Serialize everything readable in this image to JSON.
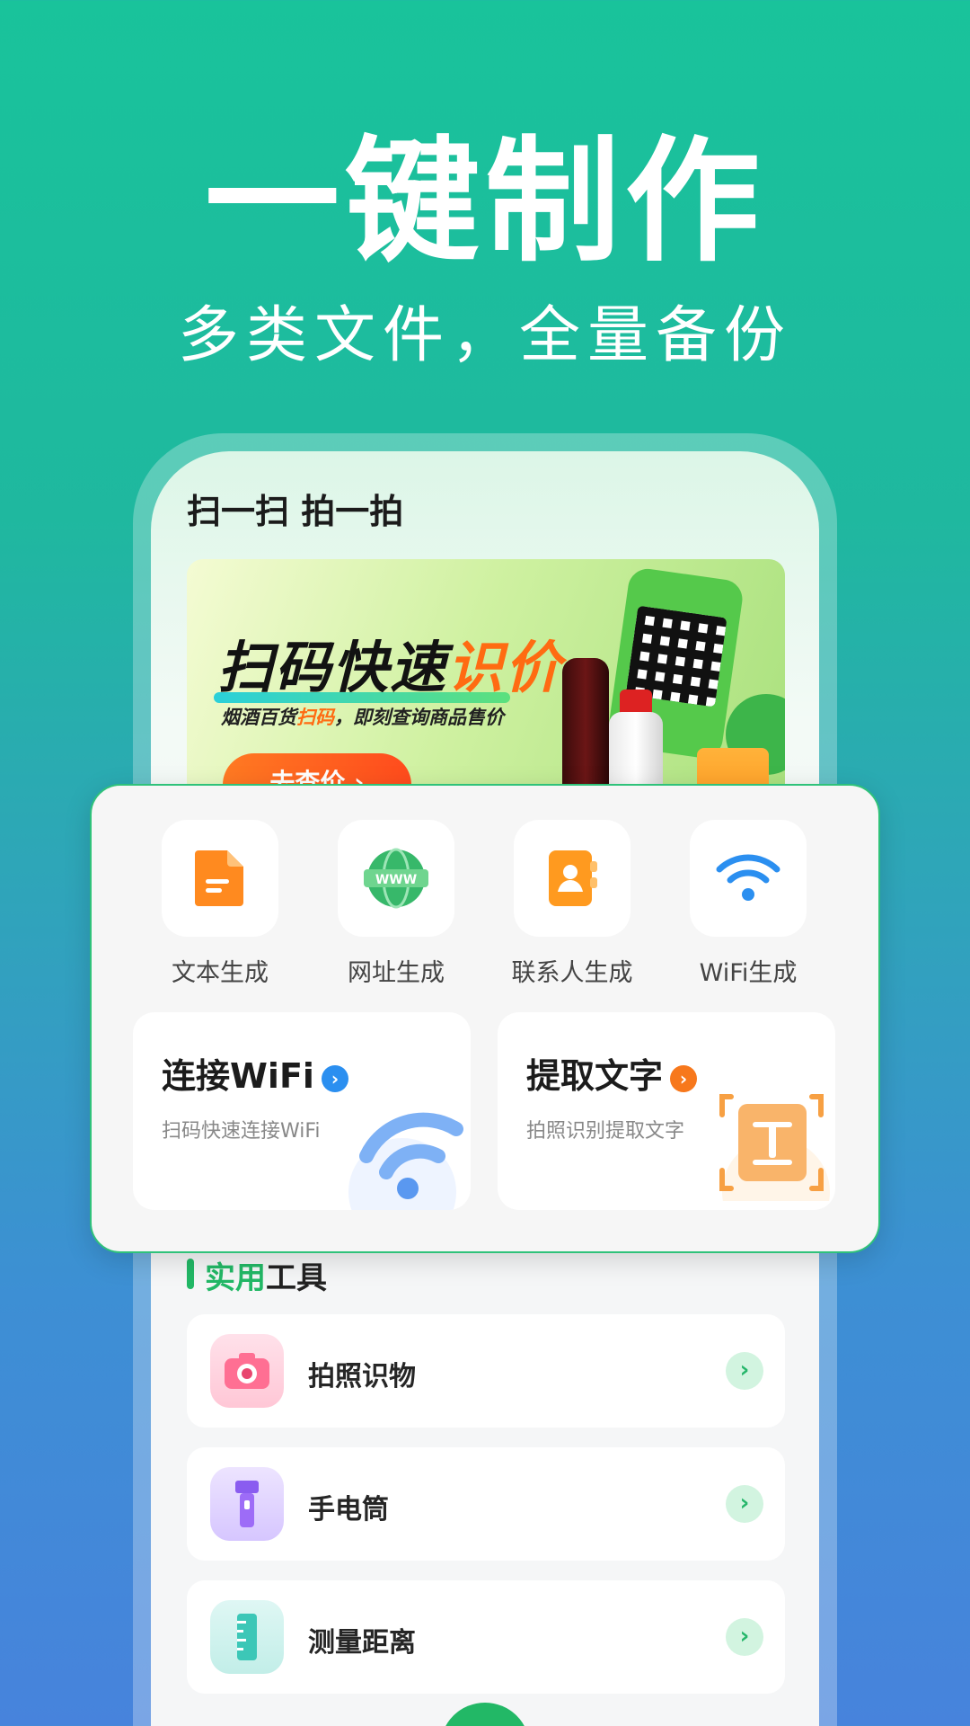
{
  "hero": {
    "title": "一键制作",
    "subtitle": "多类文件，全量备份"
  },
  "screen": {
    "title": "扫一扫 拍一拍",
    "banner": {
      "title_main": "扫码快速",
      "title_highlight": "识价",
      "desc_prefix": "烟酒百货",
      "desc_highlight": "扫码",
      "desc_suffix": "，即刻查询商品售价",
      "button": "去查价 ›"
    }
  },
  "grid": [
    {
      "label": "文本生成",
      "icon": "document-icon"
    },
    {
      "label": "网址生成",
      "icon": "globe-www-icon"
    },
    {
      "label": "联系人生成",
      "icon": "contact-book-icon"
    },
    {
      "label": "WiFi生成",
      "icon": "wifi-icon"
    }
  ],
  "features": [
    {
      "title": "连接WiFi",
      "subtitle": "扫码快速连接WiFi",
      "accent": "#2b8ff0",
      "icon": "wifi-icon"
    },
    {
      "title": "提取文字",
      "subtitle": "拍照识别提取文字",
      "accent": "#f7781c",
      "icon": "text-scan-icon"
    }
  ],
  "tools": {
    "title_accent": "实用",
    "title_rest": "工具",
    "items": [
      {
        "label": "拍照识物",
        "icon": "camera-icon"
      },
      {
        "label": "手电筒",
        "icon": "flashlight-icon"
      },
      {
        "label": "测量距离",
        "icon": "ruler-icon"
      }
    ],
    "arrow": "›"
  },
  "colors": {
    "brand_green": "#22b866",
    "orange": "#f7781c",
    "blue": "#2b8ff0"
  }
}
